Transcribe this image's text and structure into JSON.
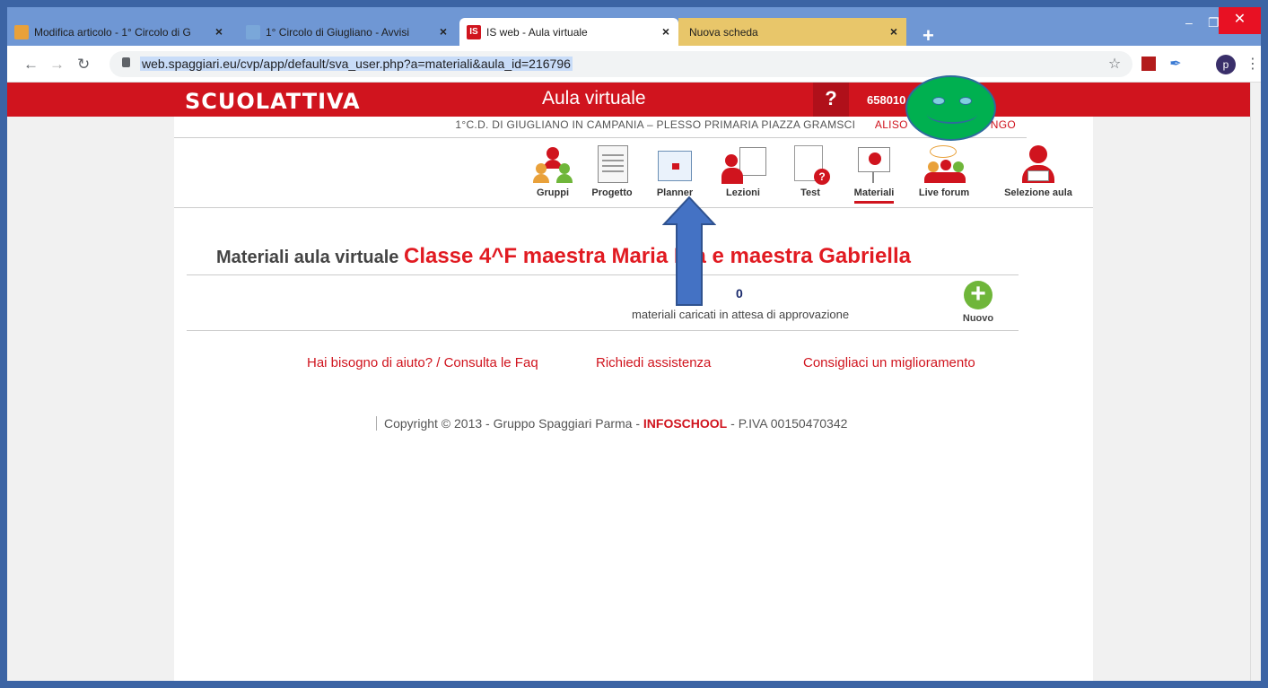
{
  "browser": {
    "tabs": [
      {
        "title": "Modifica articolo - 1° Circolo di G",
        "color": "#e9a13a"
      },
      {
        "title": "1° Circolo di Giugliano - Avvisi",
        "color": "#7aa7d9"
      },
      {
        "title": "IS web - Aula virtuale",
        "color": "#d0141e",
        "fav": "IS"
      },
      {
        "title": "Nuova scheda",
        "color": "#e8c66a"
      }
    ],
    "new_tab": "+",
    "url": "web.spaggiari.eu/cvp/app/default/sva_user.php?a=materiali&aula_id=216796",
    "profile_initial": "p"
  },
  "header": {
    "logo": "SCUOLATTIVA",
    "title": "Aula virtuale",
    "help": "?",
    "user_id": "658010",
    "school": "1°C.D. DI GIUGLIANO IN CAMPANIA – PLESSO PRIMARIA PIAZZA GRAMSCI",
    "user_name": "ALISO",
    "user_suffix": "NGO"
  },
  "menu": [
    {
      "label": "Gruppi",
      "icon": "groups-icon"
    },
    {
      "label": "Progetto",
      "icon": "document-icon"
    },
    {
      "label": "Planner",
      "icon": "calendar-icon"
    },
    {
      "label": "Lezioni",
      "icon": "lesson-icon"
    },
    {
      "label": "Test",
      "icon": "test-icon"
    },
    {
      "label": "Materiali",
      "icon": "materials-icon"
    },
    {
      "label": "Live forum",
      "icon": "forum-icon"
    },
    {
      "label": "Selezione aula",
      "icon": "classroom-select-icon"
    }
  ],
  "main": {
    "title_prefix": "Materiali aula virtuale",
    "class_name": "Classe 4^F maestra Maria Pia e maestra Gabriella",
    "pending_count": "0",
    "pending_label": "materiali caricati in attesa di approvazione",
    "new_label": "Nuovo"
  },
  "links": {
    "help": "Hai bisogno di aiuto? / Consulta le Faq",
    "assistance": "Richiedi assistenza",
    "improve": "Consigliaci un miglioramento"
  },
  "footer": {
    "copyright": "Copyright © 2013 - Gruppo Spaggiari Parma - ",
    "brand": "INFOSCHOOL",
    "vat": " - P.IVA 00150470342"
  },
  "colors": {
    "brand_red": "#d0141e",
    "tabstrip": "#6f97d4",
    "overlay_green": "#00b050",
    "arrow_blue": "#4472c4"
  }
}
